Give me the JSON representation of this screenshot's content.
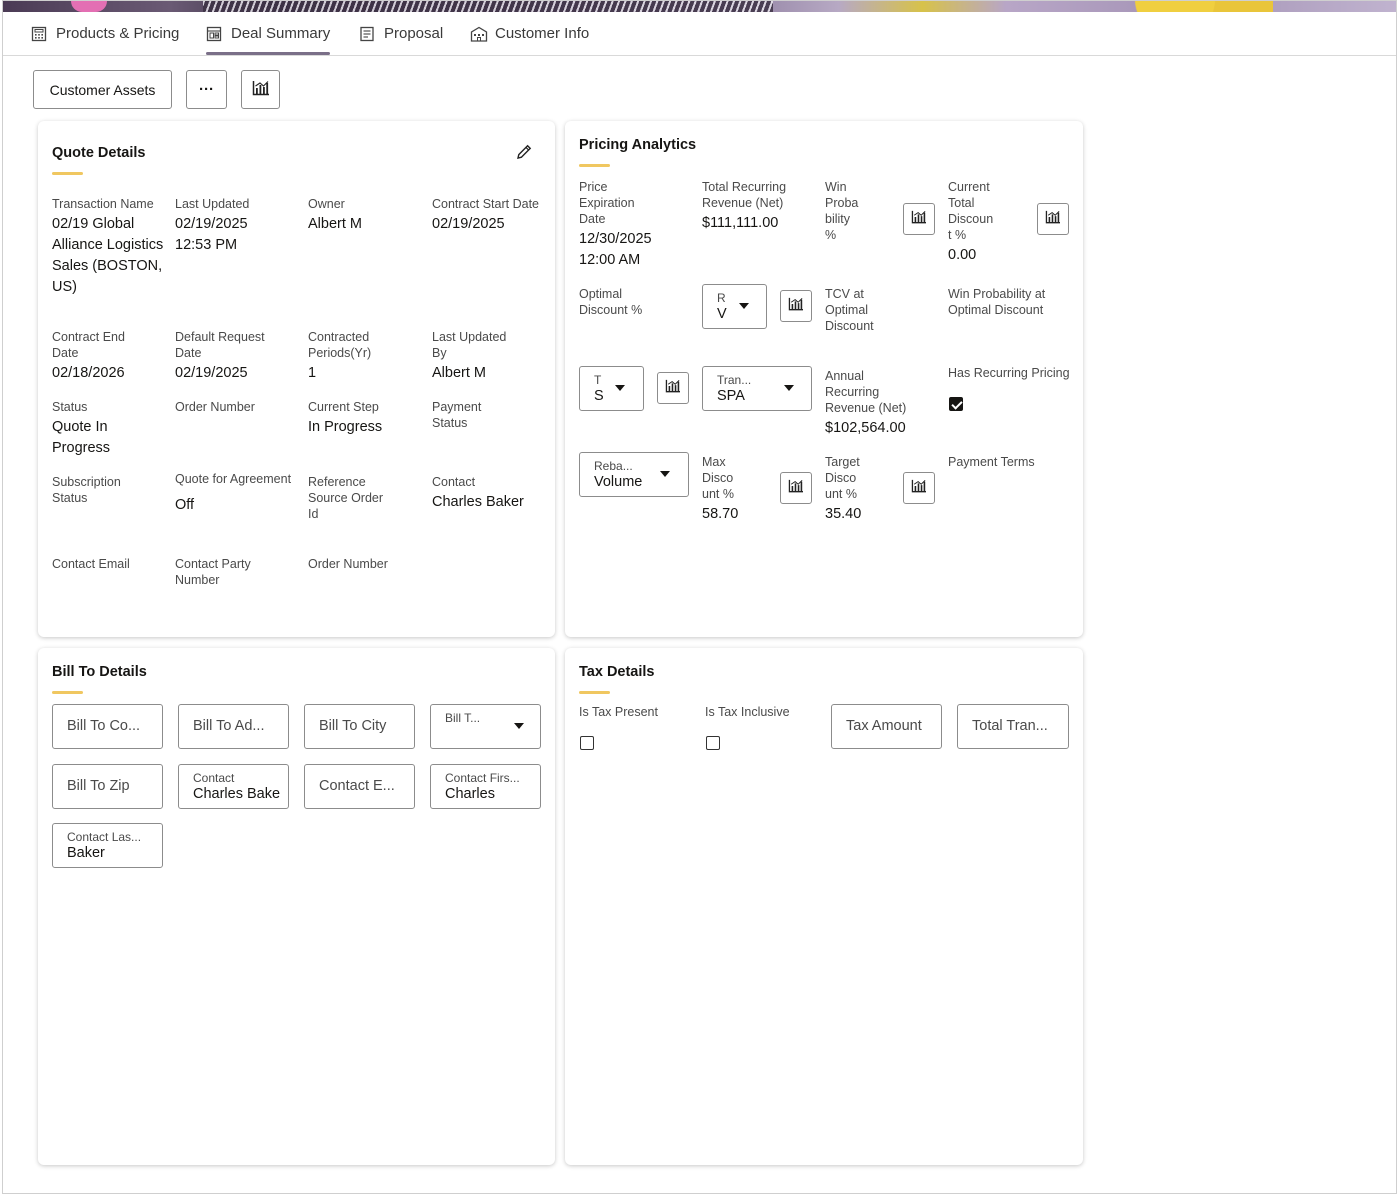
{
  "tabs": [
    {
      "label": "Products & Pricing",
      "icon": "calculator-icon"
    },
    {
      "label": "Deal Summary",
      "icon": "dashboard-icon",
      "active": true
    },
    {
      "label": "Proposal",
      "icon": "document-icon"
    },
    {
      "label": "Customer Info",
      "icon": "building-icon"
    }
  ],
  "toolbar": {
    "customer_assets": "Customer Assets",
    "more": "···"
  },
  "quote_details": {
    "title": "Quote Details",
    "fields": {
      "transaction_name": {
        "label": "Transaction Name",
        "value": "02/19 Global Alliance Logistics Sales (BOSTON, US)"
      },
      "last_updated": {
        "label": "Last Updated",
        "value": "02/19/2025 12:53 PM"
      },
      "owner": {
        "label": "Owner",
        "value": "Albert M"
      },
      "contract_start": {
        "label": "Contract Start Date",
        "value": "02/19/2025"
      },
      "contract_end": {
        "label": "Contract End Date",
        "value": "02/18/2026"
      },
      "default_request": {
        "label": "Default Request Date",
        "value": "02/19/2025"
      },
      "contracted_periods": {
        "label": "Contracted Periods(Yr)",
        "value": "1"
      },
      "last_updated_by": {
        "label": "Last Updated By",
        "value": "Albert M"
      },
      "status": {
        "label": "Status",
        "value": "Quote In Progress"
      },
      "order_number": {
        "label": "Order Number",
        "value": ""
      },
      "current_step": {
        "label": "Current Step",
        "value": "In Progress"
      },
      "payment_status": {
        "label": "Payment Status",
        "value": ""
      },
      "subscription_status": {
        "label": "Subscription Status",
        "value": ""
      },
      "quote_for_agreement": {
        "label": "Quote for Agreement",
        "value": "Off"
      },
      "reference_source": {
        "label": "Reference Source Order Id",
        "value": ""
      },
      "contact": {
        "label": "Contact",
        "value": "Charles Baker"
      },
      "contact_email": {
        "label": "Contact Email",
        "value": ""
      },
      "contact_party": {
        "label": "Contact Party Number",
        "value": ""
      },
      "order_number_2": {
        "label": "Order Number",
        "value": ""
      }
    }
  },
  "pricing_analytics": {
    "title": "Pricing Analytics",
    "price_expiration": {
      "label": "Price Expiration Date",
      "value": "12/30/2025 12:00 AM"
    },
    "total_recurring": {
      "label": "Total Recurring Revenue (Net)",
      "value": "$111,111.00"
    },
    "win_probability": {
      "label": "Win Proba bility %",
      "value": ""
    },
    "current_total_discount": {
      "label": "Current Total Discoun t %",
      "value": "0.00"
    },
    "optimal_discount": {
      "label": "Optimal Discount %",
      "value": ""
    },
    "select_r": {
      "label": "R",
      "value": "V"
    },
    "tcv_optimal": {
      "label": "TCV at Optimal Discount",
      "value": ""
    },
    "win_prob_optimal": {
      "label": "Win Probability at Optimal Discount",
      "value": ""
    },
    "select_t": {
      "label": "T",
      "value": "S"
    },
    "select_tran": {
      "label": "Tran...",
      "value": "SPA"
    },
    "annual_recurring": {
      "label": "Annual Recurring Revenue (Net)",
      "value": "$102,564.00"
    },
    "has_recurring": {
      "label": "Has Recurring Pricing",
      "checked": true
    },
    "select_reba": {
      "label": "Reba...",
      "value": "Volume"
    },
    "max_discount": {
      "label": "Max Disco unt %",
      "value": "58.70"
    },
    "target_discount": {
      "label": "Target Disco unt %",
      "value": "35.40"
    },
    "payment_terms": {
      "label": "Payment Terms",
      "value": ""
    }
  },
  "bill_to": {
    "title": "Bill To Details",
    "bill_to_co": "Bill To Co...",
    "bill_to_ad": "Bill To Ad...",
    "bill_to_city": "Bill To City",
    "bill_t_select": "Bill T...",
    "bill_to_zip": "Bill To Zip",
    "contact": {
      "label": "Contact",
      "value": "Charles Bake"
    },
    "contact_e": "Contact E...",
    "contact_first": {
      "label": "Contact Firs...",
      "value": "Charles"
    },
    "contact_last": {
      "label": "Contact Las...",
      "value": "Baker"
    }
  },
  "tax_details": {
    "title": "Tax Details",
    "is_tax_present": {
      "label": "Is Tax Present",
      "checked": false
    },
    "is_tax_inclusive": {
      "label": "Is Tax Inclusive",
      "checked": false
    },
    "tax_amount": "Tax Amount",
    "total_tran": "Total Tran..."
  }
}
